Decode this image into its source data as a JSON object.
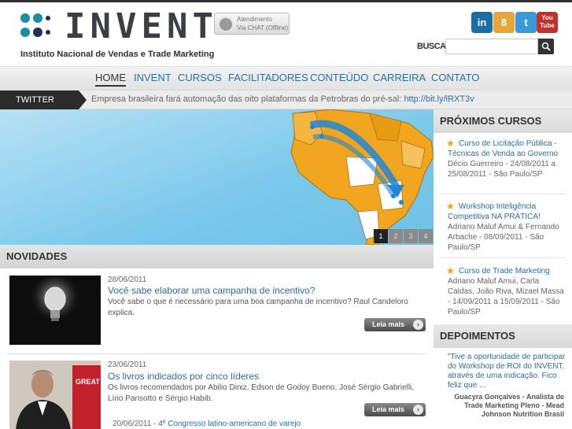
{
  "header": {
    "logo_text": "INVENT",
    "logo_subtitle": "Instituto Nacional de Vendas e Trade Marketing",
    "chat": {
      "line1": "Atendimento",
      "line2": "Via CHAT (Offline)"
    },
    "social": [
      {
        "name": "linkedin",
        "label": "in",
        "color": "#1a6ea8"
      },
      {
        "name": "orkut",
        "label": "8",
        "color": "#e7a53c"
      },
      {
        "name": "twitter",
        "label": "t",
        "color": "#3a9ad9"
      },
      {
        "name": "youtube",
        "label": "You Tube",
        "color": "#c4302b"
      }
    ],
    "search": {
      "label": "BUSCAR",
      "placeholder": ""
    }
  },
  "nav": {
    "items": [
      "HOME",
      "INVENT",
      "CURSOS",
      "FACILITADORES",
      "CONTEÚDO",
      "CARREIRA",
      "CONTATO"
    ],
    "active": "HOME"
  },
  "twitter": {
    "label": "TWITTER",
    "text": "Empresa brasileira fará automação das oito plataformas da Petrobras do pré-sal:",
    "link": "http://bit.ly/lRXT3v"
  },
  "slider": {
    "pages": [
      "1",
      "2",
      "3",
      "4"
    ],
    "active_page": "1"
  },
  "sidebar": {
    "courses_title": "PRÓXIMOS CURSOS",
    "courses": [
      {
        "title": "Curso de Licitação Pública - Técnicas de Venda ao Governo",
        "meta": "Décio Guerreiro - 24/08/2011 a 25/08/2011 - São Paulo/SP"
      },
      {
        "title": "Workshop Inteligência Competitiva NA PRÁTICA!",
        "meta": "Adriano Maluf Amui & Fernando Arbache - 08/09/2011 - São Paulo/SP"
      },
      {
        "title": "Curso de Trade Marketing",
        "meta": "Adriano Maluf Amui, Carla Caldas, João Riva, Mizael Massa - 14/09/2011 a 15/09/2011 - São Paulo/SP"
      }
    ],
    "testimonials_title": "DEPOIMENTOS",
    "testimonial_text": "\"Tive a oportunidade de participar do Workshop de ROI do INVENT, através de uma indicação. Fico feliz que ...",
    "testimonial_author": "Guacyra Gonçalves - Analista de Trade Marketing Pleno - Mead Johnson Nutrition Brasil"
  },
  "news": {
    "title": "NOVIDADES",
    "items": [
      {
        "date": "28/06/2011",
        "title": "Você sabe elaborar uma campanha de incentivo?",
        "excerpt": "Você sabe o que é necessário para uma boa campanha de incentivo? Raul Candeloro explica.",
        "read_more": "Leia mais"
      },
      {
        "date": "23/06/2011",
        "title": "Os livros indicados por cinco líderes",
        "excerpt": "Os livros recomendados por Abilio Diniz, Edson de Godoy Bueno, José Sérgio Gabrielli, Lírio Parisotto e Sérgio Habib.",
        "read_more": "Leia mais"
      }
    ],
    "more": {
      "date": "20/06/2011 -",
      "title": "4º Congresso latino-americano de varejo"
    },
    "book_label": "GREAT"
  },
  "colors": {
    "dot_teal": "#1a8ea3",
    "dot_navy": "#21305a",
    "map_orange": "#f2a51e",
    "link_blue": "#2a6ea6"
  }
}
